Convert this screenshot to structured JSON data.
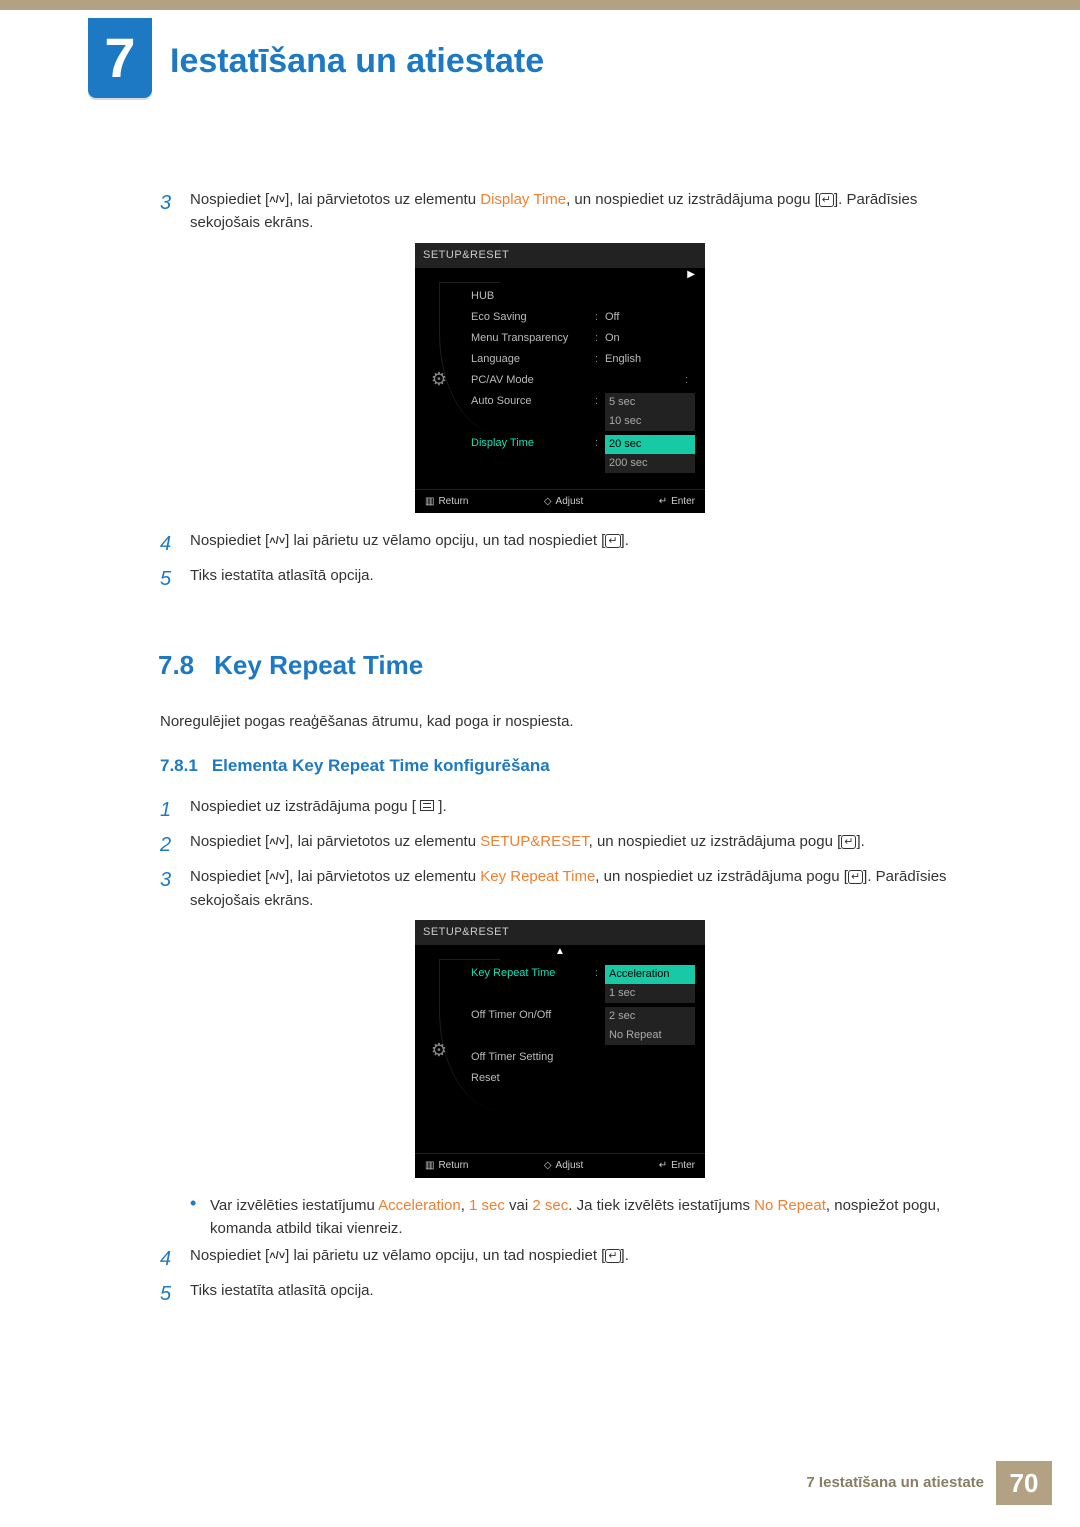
{
  "chapter": {
    "number": "7",
    "title": "Iestatīšana un atiestate"
  },
  "step3": {
    "num": "3",
    "t1": "Nospiediet [",
    "t2": "], lai pārvietotos uz elementu ",
    "highlight": "Display Time",
    "t3": ", un nospiediet uz izstrādājuma pogu [",
    "t4": "]. Parādīsies sekojošais ekrāns."
  },
  "osd1": {
    "title": "SETUP&RESET",
    "arrow": "▶",
    "items": [
      {
        "label": "HUB",
        "val": ""
      },
      {
        "label": "Eco Saving",
        "val": "Off"
      },
      {
        "label": "Menu Transparency",
        "val": "On"
      },
      {
        "label": "Language",
        "val": "English"
      },
      {
        "label": "PC/AV Mode",
        "val": ""
      },
      {
        "label": "Auto Source",
        "val": ""
      }
    ],
    "active": "Display Time",
    "options": [
      "5 sec",
      "10 sec",
      "20 sec",
      "200 sec"
    ],
    "options_hl_index": 2,
    "footer": {
      "return": "Return",
      "adjust": "Adjust",
      "enter": "Enter"
    }
  },
  "step4": {
    "num": "4",
    "t1": "Nospiediet [",
    "t2": "] lai pārietu uz vēlamo opciju, un tad nospiediet [",
    "t3": "]."
  },
  "step5": {
    "num": "5",
    "text": "Tiks iestatīta atlasītā opcija."
  },
  "section78": {
    "num": "7.8",
    "title": "Key Repeat Time"
  },
  "section78_desc": "Noregulējiet pogas reaģēšanas ātrumu, kad poga ir nospiesta.",
  "section781": {
    "num": "7.8.1",
    "title": "Elementa Key Repeat Time konfigurēšana"
  },
  "s781_step1": {
    "num": "1",
    "t1": "Nospiediet uz izstrādājuma pogu [ ",
    "t2": " ]."
  },
  "s781_step2": {
    "num": "2",
    "t1": "Nospiediet [",
    "t2": "], lai pārvietotos uz elementu ",
    "highlight": "SETUP&RESET",
    "t3": ", un nospiediet uz izstrādājuma pogu [",
    "t4": "]."
  },
  "s781_step3": {
    "num": "3",
    "t1": "Nospiediet [",
    "t2": "], lai pārvietotos uz elementu ",
    "highlight": "Key Repeat Time",
    "t3": ", un nospiediet uz izstrādājuma pogu [",
    "t4": "]. Parādīsies sekojošais ekrāns."
  },
  "osd2": {
    "title": "SETUP&RESET",
    "arrow": "▲",
    "active": "Key Repeat Time",
    "items": [
      {
        "label": "Off Timer On/Off"
      },
      {
        "label": "Off Timer Setting"
      },
      {
        "label": "Reset"
      }
    ],
    "options": [
      "Acceleration",
      "1 sec",
      "2 sec",
      "No Repeat"
    ],
    "options_hl_index": 0,
    "footer": {
      "return": "Return",
      "adjust": "Adjust",
      "enter": "Enter"
    }
  },
  "s781_bullet": {
    "t1": "Var izvēlēties iestatījumu ",
    "h1": "Acceleration",
    "t2": ", ",
    "h2": "1 sec",
    "t3": " vai ",
    "h3": "2 sec",
    "t4": ". Ja tiek izvēlēts iestatījums ",
    "h4": "No Repeat",
    "t5": ", nospiežot pogu, komanda atbild tikai vienreiz."
  },
  "s781_step4": {
    "num": "4",
    "t1": "Nospiediet [",
    "t2": "] lai pārietu uz vēlamo opciju, un tad nospiediet [",
    "t3": "]."
  },
  "s781_step5": {
    "num": "5",
    "text": "Tiks iestatīta atlasītā opcija."
  },
  "footer": {
    "label": "7 Iestatīšana un atiestate",
    "page": "70"
  }
}
